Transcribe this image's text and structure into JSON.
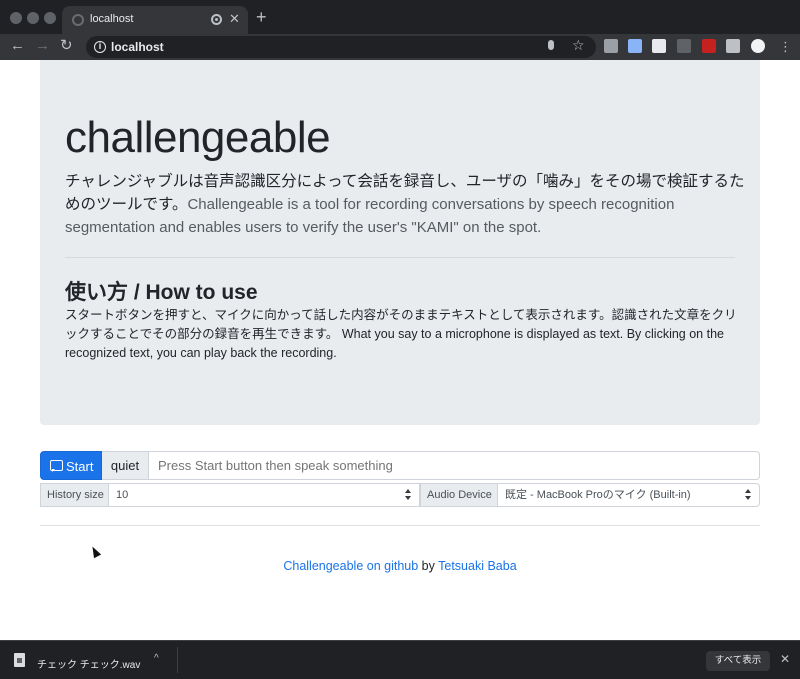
{
  "browser": {
    "tab_title": "localhost",
    "tab_close": "✕",
    "new_tab": "+",
    "url": "localhost",
    "back_glyph": "←",
    "forward_glyph": "→",
    "reload_glyph": "↻",
    "info_glyph": "i",
    "star_glyph": "☆",
    "extension_colors": [
      "#9aa0a6",
      "#8ab4f8",
      "#e8eaed",
      "#5f6368",
      "#c5221f",
      "#bdc1c6",
      "#f1f3f4"
    ]
  },
  "page": {
    "title": "challengeable",
    "lead_ja": "チャレンジャブルは音声認識区分によって会話を録音し、ユーザの「噛み」をその場で検証するためのツールです。",
    "lead_en": "Challengeable is a tool for recording conversations by speech recognition segmentation and enables users to verify the user's \"KAMI\" on the spot.",
    "howto_ja": "使い方 / ",
    "howto_en": "How to use",
    "howto_text": "スタートボタンを押すと、マイクに向かって話した内容がそのままテキストとして表示されます。認識された文章をクリックすることでその部分の録音を再生できます。 What you say to a microphone is displayed as text. By clicking on the recognized text, you can play back the recording."
  },
  "controls": {
    "start_label": "Start",
    "quiet_label": "quiet",
    "speech_placeholder": "Press Start button then speak something",
    "history_label": "History size",
    "history_value": "10",
    "audio_label": "Audio Device",
    "audio_value": "既定 - MacBook Proのマイク (Built-in)"
  },
  "footer": {
    "repo_link": "Challengeable on github",
    "by": "by",
    "author_link": "Tetsuaki Baba"
  },
  "download": {
    "filename": "チェック チェック.wav",
    "chevron": "^",
    "show_all": "すべて表示",
    "close": "✕"
  }
}
